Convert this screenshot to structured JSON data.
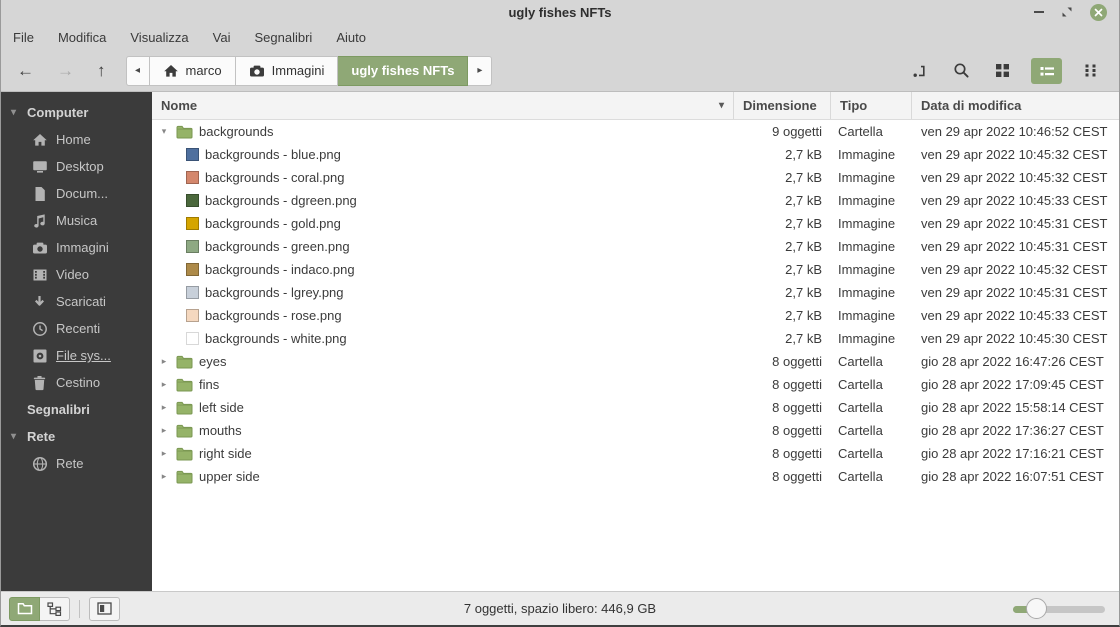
{
  "window": {
    "title": "ugly fishes NFTs"
  },
  "menubar": {
    "items": [
      "File",
      "Modifica",
      "Visualizza",
      "Vai",
      "Segnalibri",
      "Aiuto"
    ]
  },
  "toolbar": {
    "breadcrumbs": [
      {
        "label": "marco",
        "icon": "home",
        "active": false
      },
      {
        "label": "Immagini",
        "icon": "camera",
        "active": false
      },
      {
        "label": "ugly fishes NFTs",
        "icon": null,
        "active": true
      }
    ]
  },
  "sidebar": {
    "sections": [
      {
        "header": "Computer",
        "collapsible": true,
        "items": [
          {
            "label": "Home",
            "icon": "home"
          },
          {
            "label": "Desktop",
            "icon": "desktop"
          },
          {
            "label": "Docum...",
            "icon": "document"
          },
          {
            "label": "Musica",
            "icon": "music"
          },
          {
            "label": "Immagini",
            "icon": "camera"
          },
          {
            "label": "Video",
            "icon": "video"
          },
          {
            "label": "Scaricati",
            "icon": "download"
          },
          {
            "label": "Recenti",
            "icon": "clock"
          },
          {
            "label": "File sys...",
            "icon": "harddisk",
            "underlined": true
          },
          {
            "label": "Cestino",
            "icon": "trash"
          }
        ]
      },
      {
        "header": "Segnalibri",
        "collapsible": false,
        "items": []
      },
      {
        "header": "Rete",
        "collapsible": true,
        "items": [
          {
            "label": "Rete",
            "icon": "globe"
          }
        ]
      }
    ]
  },
  "filelist": {
    "columns": [
      {
        "label": "Nome"
      },
      {
        "label": "Dimensione"
      },
      {
        "label": "Tipo"
      },
      {
        "label": "Data di modifica"
      }
    ],
    "sort": {
      "column": "Nome",
      "direction": "descending-arrow"
    },
    "rows": [
      {
        "name": "backgrounds",
        "size": "9 oggetti",
        "type": "Cartella",
        "date": "ven 29 apr 2022 10:46:52 CEST",
        "kind": "folder",
        "level": 0,
        "expanded": true
      },
      {
        "name": "backgrounds - blue.png",
        "size": "2,7 kB",
        "type": "Immagine",
        "date": "ven 29 apr 2022 10:45:32 CEST",
        "kind": "image",
        "level": 1,
        "thumb_color": "#4e6f9e"
      },
      {
        "name": "backgrounds - coral.png",
        "size": "2,7 kB",
        "type": "Immagine",
        "date": "ven 29 apr 2022 10:45:32 CEST",
        "kind": "image",
        "level": 1,
        "thumb_color": "#d4876c"
      },
      {
        "name": "backgrounds - dgreen.png",
        "size": "2,7 kB",
        "type": "Immagine",
        "date": "ven 29 apr 2022 10:45:33 CEST",
        "kind": "image",
        "level": 1,
        "thumb_color": "#4b683c"
      },
      {
        "name": "backgrounds - gold.png",
        "size": "2,7 kB",
        "type": "Immagine",
        "date": "ven 29 apr 2022 10:45:31 CEST",
        "kind": "image",
        "level": 1,
        "thumb_color": "#d5a500"
      },
      {
        "name": "backgrounds - green.png",
        "size": "2,7 kB",
        "type": "Immagine",
        "date": "ven 29 apr 2022 10:45:31 CEST",
        "kind": "image",
        "level": 1,
        "thumb_color": "#8ea983"
      },
      {
        "name": "backgrounds - indaco.png",
        "size": "2,7 kB",
        "type": "Immagine",
        "date": "ven 29 apr 2022 10:45:32 CEST",
        "kind": "image",
        "level": 1,
        "thumb_color": "#ad8a49"
      },
      {
        "name": "backgrounds - lgrey.png",
        "size": "2,7 kB",
        "type": "Immagine",
        "date": "ven 29 apr 2022 10:45:31 CEST",
        "kind": "image",
        "level": 1,
        "thumb_color": "#c8d0da"
      },
      {
        "name": "backgrounds - rose.png",
        "size": "2,7 kB",
        "type": "Immagine",
        "date": "ven 29 apr 2022 10:45:33 CEST",
        "kind": "image",
        "level": 1,
        "thumb_color": "#f5d8bf"
      },
      {
        "name": "backgrounds - white.png",
        "size": "2,7 kB",
        "type": "Immagine",
        "date": "ven 29 apr 2022 10:45:30 CEST",
        "kind": "image",
        "level": 1,
        "thumb_color": "#ffffff"
      },
      {
        "name": "eyes",
        "size": "8 oggetti",
        "type": "Cartella",
        "date": "gio 28 apr 2022 16:47:26 CEST",
        "kind": "folder",
        "level": 0,
        "expanded": false
      },
      {
        "name": "fins",
        "size": "8 oggetti",
        "type": "Cartella",
        "date": "gio 28 apr 2022 17:09:45 CEST",
        "kind": "folder",
        "level": 0,
        "expanded": false
      },
      {
        "name": "left side",
        "size": "8 oggetti",
        "type": "Cartella",
        "date": "gio 28 apr 2022 15:58:14 CEST",
        "kind": "folder",
        "level": 0,
        "expanded": false
      },
      {
        "name": "mouths",
        "size": "8 oggetti",
        "type": "Cartella",
        "date": "gio 28 apr 2022 17:36:27 CEST",
        "kind": "folder",
        "level": 0,
        "expanded": false
      },
      {
        "name": "right side",
        "size": "8 oggetti",
        "type": "Cartella",
        "date": "gio 28 apr 2022 17:16:21 CEST",
        "kind": "folder",
        "level": 0,
        "expanded": false
      },
      {
        "name": "upper side",
        "size": "8 oggetti",
        "type": "Cartella",
        "date": "gio 28 apr 2022 16:07:51 CEST",
        "kind": "folder",
        "level": 0,
        "expanded": false
      }
    ]
  },
  "statusbar": {
    "text": "7 oggetti, spazio libero: 446,9 GB"
  },
  "colors": {
    "accent_green": "#8fa876",
    "folder_green": "#95b368",
    "sidebar_bg": "#3b3b3b",
    "chrome_bg": "#d6d6d6"
  }
}
